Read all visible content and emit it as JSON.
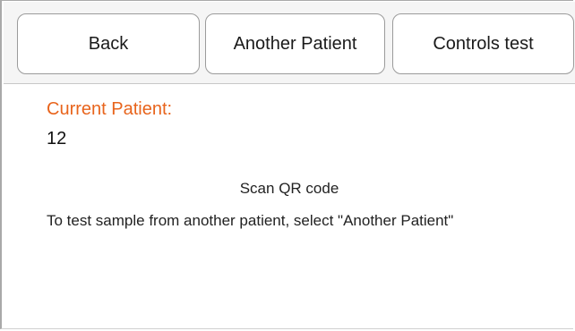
{
  "toolbar": {
    "back_label": "Back",
    "another_patient_label": "Another Patient",
    "controls_test_label": "Controls test"
  },
  "patient": {
    "label": "Current Patient:",
    "value": "12"
  },
  "messages": {
    "scan": "Scan QR code",
    "instruction": "To test sample from another patient, select \"Another Patient\""
  },
  "colors": {
    "accent": "#e8641c",
    "toolbar_bg": "#f5f5f5",
    "button_border": "#9b9b9b"
  }
}
